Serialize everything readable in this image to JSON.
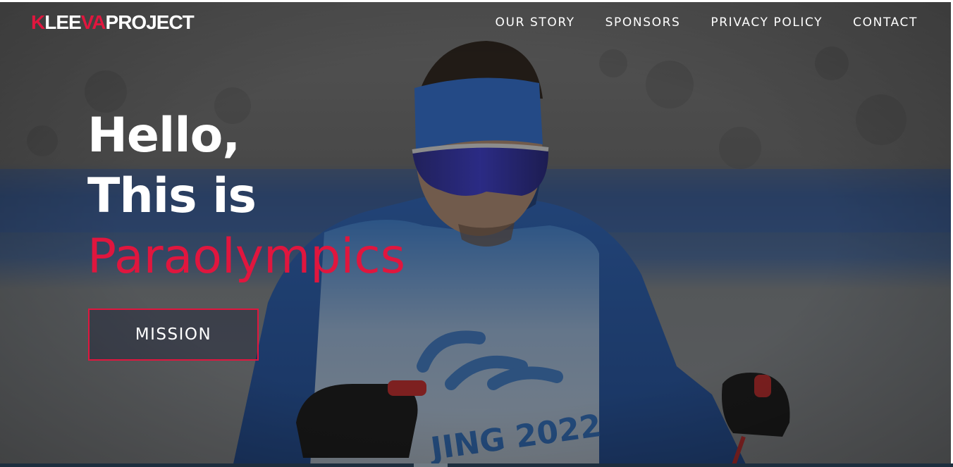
{
  "brand": {
    "logo_prefix": "K",
    "logo_mid": "LEE",
    "logo_accent": "VA",
    "logo_suffix": "PROJECT",
    "accent_color": "#e0163e"
  },
  "nav": {
    "items": [
      {
        "label": "OUR STORY"
      },
      {
        "label": "SPONSORS"
      },
      {
        "label": "PRIVACY POLICY"
      },
      {
        "label": "CONTACT"
      }
    ]
  },
  "hero": {
    "line1": "Hello,",
    "line2": "This is",
    "line3": "Paraolympics",
    "cta_label": "MISSION",
    "background_icon": "skier-photo"
  }
}
